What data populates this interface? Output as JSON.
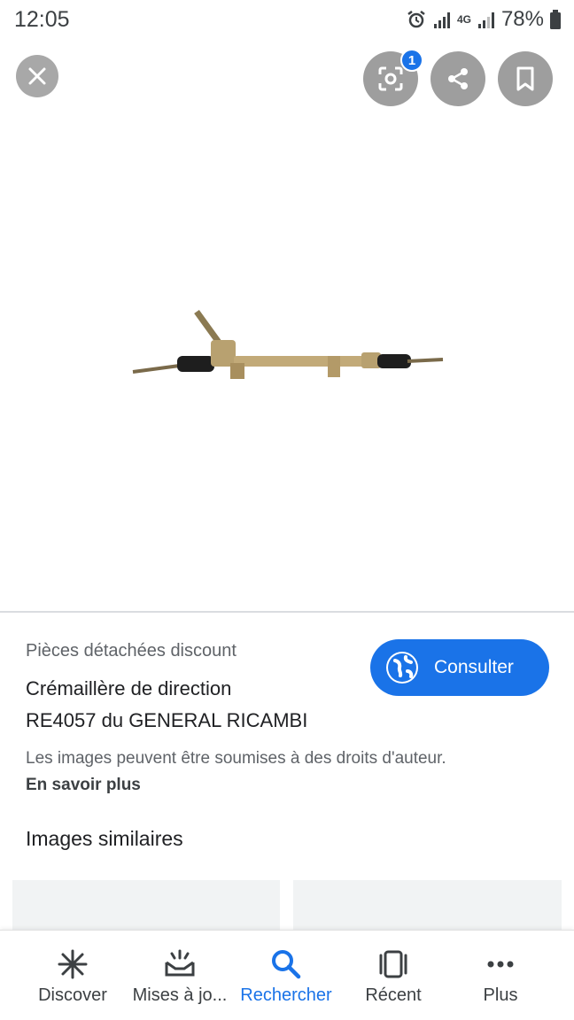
{
  "status_bar": {
    "time": "12:05",
    "battery": "78%",
    "network": "4G"
  },
  "top_actions": {
    "lens_badge_count": "1"
  },
  "result": {
    "source": "Pièces détachées discount",
    "title_line1": "Crémaillère de direction",
    "title_line2": "RE4057 du GENERAL RICAMBI",
    "consult_label": "Consulter",
    "copyright_notice": "Les images peuvent être soumises à des droits d'auteur.",
    "learn_more": "En savoir plus"
  },
  "similar": {
    "heading": "Images similaires"
  },
  "bottom_nav": {
    "items": [
      {
        "label": "Discover",
        "icon": "asterisk-icon"
      },
      {
        "label": "Mises à jo...",
        "icon": "updates-icon"
      },
      {
        "label": "Rechercher",
        "icon": "search-icon",
        "active": true
      },
      {
        "label": "Récent",
        "icon": "recent-tabs-icon"
      },
      {
        "label": "Plus",
        "icon": "more-icon"
      }
    ]
  },
  "colors": {
    "accent": "#1a73e8",
    "overlay_button": "#9e9e9e"
  }
}
